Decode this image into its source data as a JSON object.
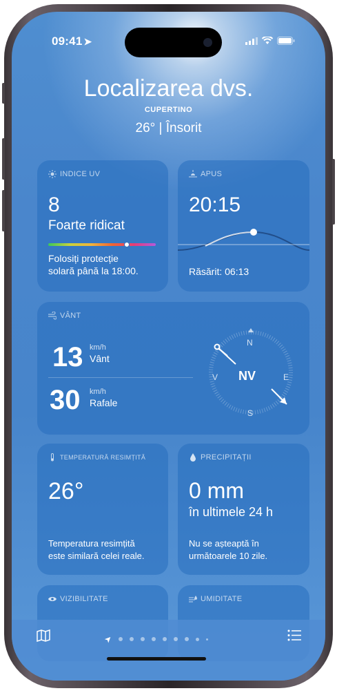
{
  "status": {
    "time": "09:41"
  },
  "hero": {
    "title": "Localizarea dvs.",
    "city": "CUPERTINO",
    "summary": "26° | Însorit"
  },
  "uv": {
    "label": "INDICE UV",
    "value": "8",
    "level": "Foarte ridicat",
    "advice": [
      "Folosiți protecție",
      "solară până la 18:00."
    ],
    "level_fraction": 0.73
  },
  "sunset": {
    "label": "APUS",
    "time": "20:15",
    "sunrise": "Răsărit: 06:13"
  },
  "wind": {
    "label": "VÂNT",
    "speed": "13",
    "speed_unit": "km/h",
    "speed_label": "Vânt",
    "gust": "30",
    "gust_unit": "km/h",
    "gust_label": "Rafale",
    "compass": {
      "n": "N",
      "s": "S",
      "e": "E",
      "w": "V",
      "dir": "NV"
    }
  },
  "feels": {
    "label": "TEMPERATURĂ RESIMȚITĂ",
    "value": "26°",
    "note": [
      "Temperatura resimțită",
      "este similară celei reale."
    ]
  },
  "precip": {
    "label": "PRECIPITAȚII",
    "value": "0 mm",
    "period": "în ultimele 24 h",
    "note": [
      "Nu se așteaptă în",
      "următoarele 10 zile."
    ]
  },
  "visibility": {
    "label": "VIZIBILITATE"
  },
  "humidity": {
    "label": "UMIDITATE"
  },
  "colors": {
    "sky": "#4a86cc",
    "card": "#2f72bf"
  },
  "icons": [
    "location-arrow-icon",
    "signal-icon",
    "wifi-icon",
    "battery-icon",
    "sun-icon",
    "sunset-icon",
    "wind-icon",
    "thermometer-icon",
    "drop-icon",
    "eye-icon",
    "humidity-icon",
    "map-icon",
    "list-icon"
  ]
}
